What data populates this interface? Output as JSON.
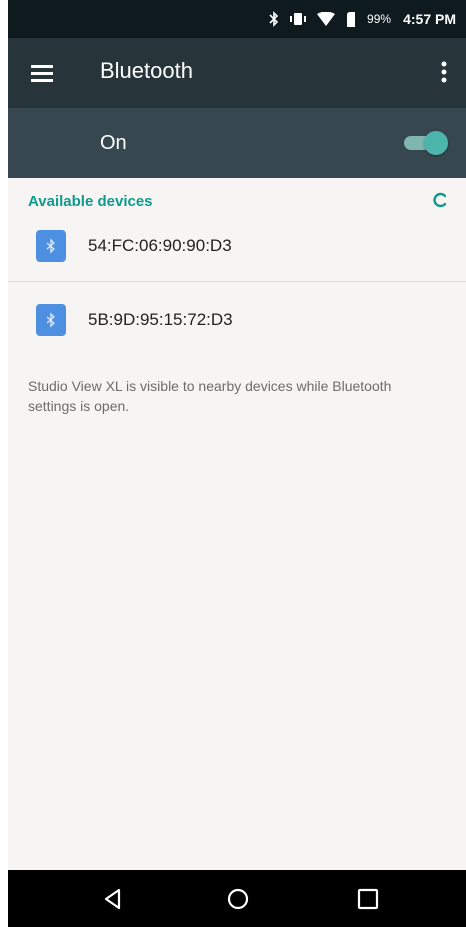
{
  "status_bar": {
    "icons": [
      "bluetooth-icon",
      "vibrate-icon",
      "wifi-icon",
      "cell-signal-icon",
      "battery-icon"
    ],
    "battery": "99%",
    "time": "4:57 PM"
  },
  "toolbar": {
    "menu_icon": "hamburger-menu-icon",
    "title": "Bluetooth",
    "overflow_icon": "more-vert-icon"
  },
  "master_switch": {
    "label": "On",
    "state": "on"
  },
  "available": {
    "header": "Available devices",
    "refresh_icon": "progress-spinner-icon",
    "devices": [
      {
        "name": "54:FC:06:90:90:D3",
        "icon": "bluetooth-icon"
      },
      {
        "name": "5B:9D:95:15:72:D3",
        "icon": "bluetooth-icon"
      }
    ]
  },
  "footer_text": "Studio View XL is visible to nearby devices while Bluetooth settings is open.",
  "nav_bar": {
    "icons": [
      "back-icon",
      "home-icon",
      "recents-icon"
    ]
  },
  "colors": {
    "toolbar": "#27343a",
    "switch_bar": "#37474f",
    "accent": "#10998c",
    "toggle_thumb": "#4db6ac",
    "device_tile": "#4d8fe0",
    "background": "#f6f5f4"
  }
}
